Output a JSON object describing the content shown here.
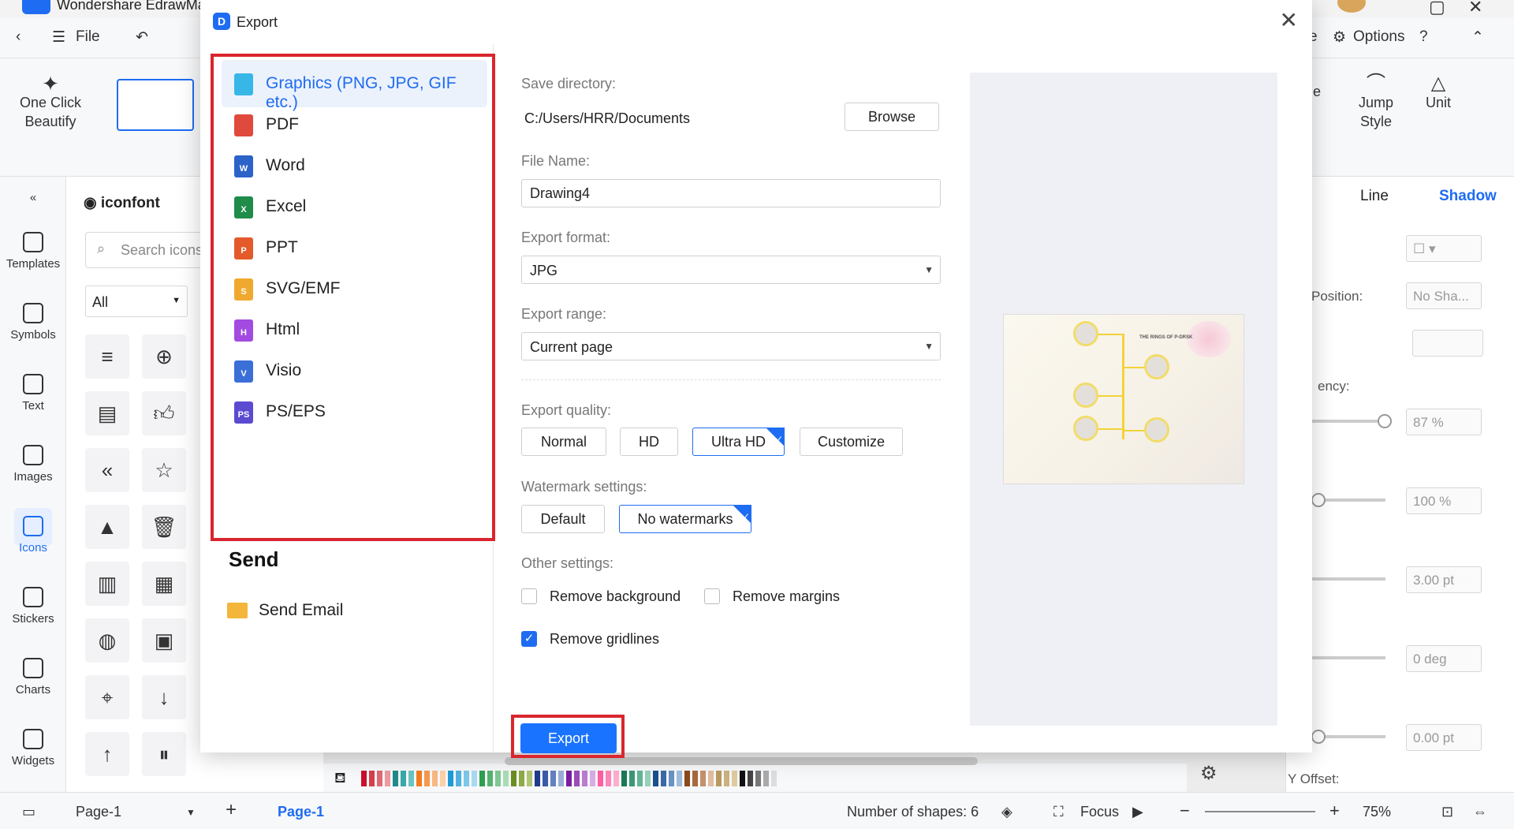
{
  "app": {
    "title": "Wondershare EdrawMa",
    "menu": {
      "file": "File",
      "options": "Options",
      "partial_left": "e"
    },
    "ribbon": {
      "one_click": "One Click Beautify",
      "jump_style": "Jump Style",
      "unit": "Unit",
      "partial_a": "ge",
      "partial_b": "e"
    },
    "leftbar": [
      "Templates",
      "Symbols",
      "Text",
      "Images",
      "Icons",
      "Stickers",
      "Charts",
      "Widgets"
    ],
    "icon_panel": {
      "brand": "iconfont",
      "search_placeholder": "Search icons",
      "filter": "All"
    },
    "right_panel": {
      "tab_line": "Line",
      "tab_shadow": "Shadow",
      "position_label": "Position:",
      "position_value": "No Sha...",
      "transparency_label": "ency:",
      "val1": "87 %",
      "val2": "100 %",
      "val3": "3.00 pt",
      "val4": "0 deg",
      "val5": "0.00 pt",
      "y_offset": "Y Offset:"
    },
    "status": {
      "page_select": "Page-1",
      "page_tab": "Page-1",
      "shapes": "Number of shapes: 6",
      "focus": "Focus",
      "zoom": "75%"
    },
    "accent": "#1e6cf2"
  },
  "dialog": {
    "title": "Export",
    "formats": [
      {
        "label": "Graphics (PNG, JPG, GIF etc.)",
        "icon": "image-file-icon",
        "color": "#38b6e8",
        "glyph": ""
      },
      {
        "label": "PDF",
        "icon": "pdf-file-icon",
        "color": "#e04a3c",
        "glyph": ""
      },
      {
        "label": "Word",
        "icon": "word-file-icon",
        "color": "#2b63c9",
        "glyph": "W"
      },
      {
        "label": "Excel",
        "icon": "excel-file-icon",
        "color": "#1f8c4a",
        "glyph": "X"
      },
      {
        "label": "PPT",
        "icon": "ppt-file-icon",
        "color": "#e45a2a",
        "glyph": "P"
      },
      {
        "label": "SVG/EMF",
        "icon": "svg-file-icon",
        "color": "#f0a92f",
        "glyph": "S"
      },
      {
        "label": "Html",
        "icon": "html-file-icon",
        "color": "#a24be0",
        "glyph": "H"
      },
      {
        "label": "Visio",
        "icon": "visio-file-icon",
        "color": "#3a6fd8",
        "glyph": "V"
      },
      {
        "label": "PS/EPS",
        "icon": "ps-file-icon",
        "color": "#5a4bd1",
        "glyph": "PS"
      }
    ],
    "selected_format": 0,
    "send": {
      "title": "Send",
      "email": "Send Email"
    },
    "save_directory": {
      "label": "Save directory:",
      "value": "C:/Users/HRR/Documents",
      "browse": "Browse"
    },
    "file_name": {
      "label": "File Name:",
      "value": "Drawing4"
    },
    "export_format": {
      "label": "Export format:",
      "value": "JPG"
    },
    "export_range": {
      "label": "Export range:",
      "value": "Current page"
    },
    "quality": {
      "label": "Export quality:",
      "options": [
        "Normal",
        "HD",
        "Ultra HD",
        "Customize"
      ],
      "selected": "Ultra HD"
    },
    "watermark": {
      "label": "Watermark settings:",
      "options": [
        "Default",
        "No watermarks"
      ],
      "selected": "No watermarks"
    },
    "other": {
      "label": "Other settings:",
      "remove_background": {
        "label": "Remove background",
        "checked": false
      },
      "remove_margins": {
        "label": "Remove margins",
        "checked": false
      },
      "remove_gridlines": {
        "label": "Remove gridlines",
        "checked": true
      }
    },
    "export_button": "Export",
    "preview_title": "THE RINGS OF P-DRSK"
  }
}
